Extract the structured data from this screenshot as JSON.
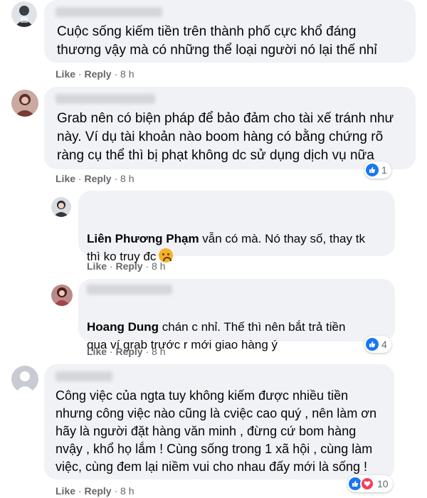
{
  "comments": [
    {
      "text": "Cuộc sống kiếm tiền trên thành phố cực khổ đáng\nthương vậy mà có những thể loại người nó lại thế nhỉ",
      "actions": {
        "like": "Like",
        "reply": "Reply",
        "time": "8 h"
      }
    },
    {
      "text": "Grab nên có biện pháp để bảo đảm cho tài xế tránh như\nnày. Ví dụ tài khoản nào boom hàng có bằng chứng rõ\nràng cụ thể thì bị phạt không dc sử dụng dịch vụ nữa",
      "actions": {
        "like": "Like",
        "reply": "Reply",
        "time": "8 h"
      },
      "reaction_count": "1"
    },
    {
      "author": "Liên Phương Phạm",
      "text": " vẫn có mà. Nó thay số, thay tk\nthì ko truy đc",
      "emoji": "sad-face-emoji",
      "actions": {
        "like": "Like",
        "reply": "Reply",
        "time": "8 h"
      }
    },
    {
      "author": "Hoang Dung",
      "text": " chán c nhỉ. Thế thì nên bắt trả tiền\nqua ví grab trước r mới giao hàng ý",
      "actions": {
        "like": "Like",
        "reply": "Reply",
        "time": "8 h"
      },
      "reaction_count": "4"
    },
    {
      "text": "Công việc của ngta tuy không kiếm được nhiều tiền\nnhưng công việc nào cũng là cviệc cao quý , nên làm ơn\nhãy là người đặt hàng văn minh , đừng cứ bom hàng\nnvậy , khổ họ lắm ! Cùng sống trong 1 xã hội , cùng làm\nviệc, cùng đem lại niềm vui cho nhau đấy mới là sống !",
      "actions": {
        "like": "Like",
        "reply": "Reply",
        "time": "8 h"
      },
      "reaction_count": "10"
    }
  ],
  "colors": {
    "bubble": "#f0f2f5",
    "meta": "#65676b",
    "like_blue": "#1877f2",
    "love_red": "#f33e58"
  }
}
